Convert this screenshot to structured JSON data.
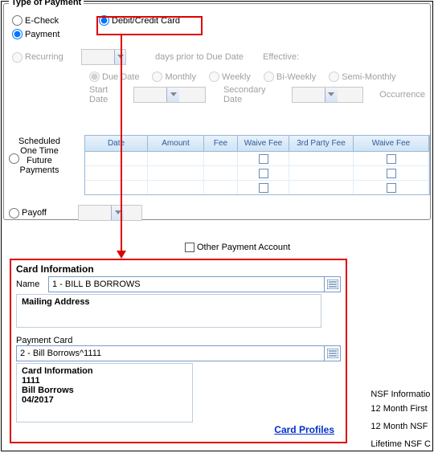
{
  "group": {
    "title": "Type of Payment"
  },
  "opts": {
    "echeck": "E-Check",
    "debit": "Debit/Credit Card",
    "payment": "Payment",
    "recurring": "Recurring",
    "payoff": "Payoff"
  },
  "labels": {
    "days_prior": "days prior to Due Date",
    "effective": "Effective:",
    "due": "Due Date",
    "monthly": "Monthly",
    "weekly": "Weekly",
    "biweekly": "Bi-Weekly",
    "semi": "Semi-Monthly",
    "start_date": "Start Date",
    "secondary": "Secondary Date",
    "occurrence": "Occurrence",
    "sched": "Scheduled\nOne Time\nFuture\nPayments",
    "other": "Other Payment Account"
  },
  "grid": {
    "cols": [
      "Date",
      "Amount",
      "Fee",
      "Waive Fee",
      "3rd Party Fee",
      "Waive Fee"
    ]
  },
  "card": {
    "section": "Card Information",
    "name_lbl": "Name",
    "name_val": "1 - BILL B BORROWS",
    "mailing": "Mailing Address",
    "pc_lbl": "Payment Card",
    "pc_val": "2 - Bill Borrows^1111",
    "info": "Card Information",
    "last4": "1111",
    "holder": "Bill Borrows",
    "exp": "04/2017",
    "profiles": "Card Profiles"
  },
  "nsf": {
    "title": "NSF Informatio",
    "l1": "12 Month First",
    "l2": "12 Month NSF",
    "l3": "Lifetime NSF C"
  }
}
